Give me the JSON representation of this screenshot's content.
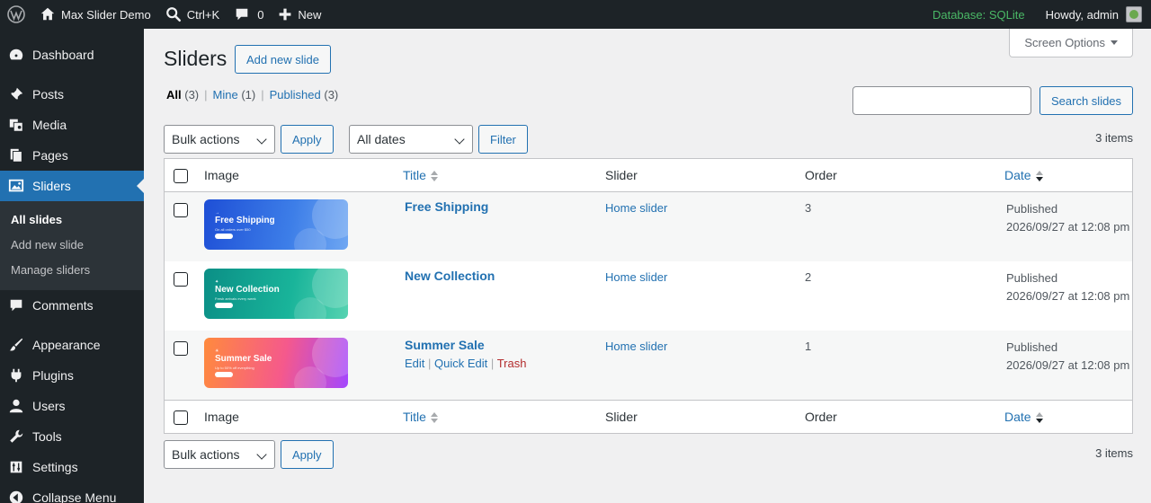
{
  "adminbar": {
    "site_name": "Max Slider Demo",
    "search_shortcut": "Ctrl+K",
    "comments_count": "0",
    "new_label": "New",
    "database_label": "Database: SQLite",
    "howdy": "Howdy, admin"
  },
  "sidebar": {
    "items": [
      {
        "label": "Dashboard",
        "icon": "dashboard-icon"
      },
      {
        "label": "Posts",
        "icon": "pin-icon"
      },
      {
        "label": "Media",
        "icon": "media-icon"
      },
      {
        "label": "Pages",
        "icon": "pages-icon"
      },
      {
        "label": "Sliders",
        "icon": "slides-icon"
      },
      {
        "label": "Comments",
        "icon": "comment-icon"
      },
      {
        "label": "Appearance",
        "icon": "brush-icon"
      },
      {
        "label": "Plugins",
        "icon": "plugin-icon"
      },
      {
        "label": "Users",
        "icon": "user-icon"
      },
      {
        "label": "Tools",
        "icon": "wrench-icon"
      },
      {
        "label": "Settings",
        "icon": "settings-icon"
      },
      {
        "label": "Collapse Menu",
        "icon": "collapse-icon"
      }
    ],
    "submenu": [
      "All slides",
      "Add new slide",
      "Manage sliders"
    ]
  },
  "header": {
    "title": "Sliders",
    "add_new": "Add new slide",
    "screen_options": "Screen Options"
  },
  "views": {
    "all": {
      "label": "All",
      "count": "(3)"
    },
    "mine": {
      "label": "Mine",
      "count": "(1)"
    },
    "published": {
      "label": "Published",
      "count": "(3)"
    },
    "sep": "|"
  },
  "search": {
    "button": "Search slides",
    "value": ""
  },
  "tablenav": {
    "bulk_actions": "Bulk actions",
    "apply": "Apply",
    "all_dates": "All dates",
    "filter": "Filter",
    "items_count": "3 items"
  },
  "table": {
    "columns": {
      "image": "Image",
      "title": "Title",
      "slider": "Slider",
      "order": "Order",
      "date": "Date"
    },
    "rows": [
      {
        "title": "Free Shipping",
        "thumb_title": "Free Shipping",
        "thumb_kicker": "→",
        "thumb_sub": "On all orders over $50",
        "slider": "Home slider",
        "order": "3",
        "status": "Published",
        "date": "2026/09/27 at 12:08 pm"
      },
      {
        "title": "New Collection",
        "thumb_title": "New Collection",
        "thumb_kicker": "✦",
        "thumb_sub": "Fresh arrivals every week",
        "slider": "Home slider",
        "order": "2",
        "status": "Published",
        "date": "2026/09/27 at 12:08 pm"
      },
      {
        "title": "Summer Sale",
        "thumb_title": "Summer Sale",
        "thumb_kicker": "☀",
        "thumb_sub": "Up to 50% off everything",
        "slider": "Home slider",
        "order": "1",
        "status": "Published",
        "date": "2026/09/27 at 12:08 pm",
        "actions": {
          "edit": "Edit",
          "quick_edit": "Quick Edit",
          "trash": "Trash",
          "sep": "|"
        }
      }
    ]
  },
  "colors": {
    "accent": "#2271b1",
    "adminbar": "#1d2327",
    "current_menu": "#2271b1",
    "db_green": "#4ab866",
    "trash": "#b32d2e"
  }
}
